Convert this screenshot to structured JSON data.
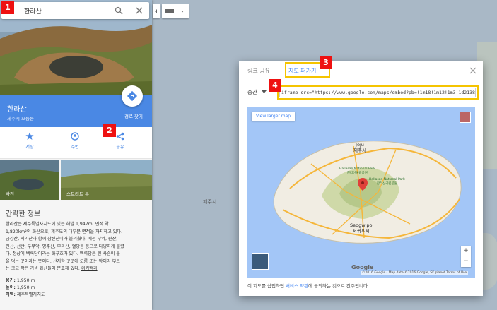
{
  "search": {
    "query": "한라산"
  },
  "place": {
    "title": "한라산",
    "subtitle": "제주시 오등동",
    "directions_label": "경로 찾기"
  },
  "actions": [
    {
      "label": "저장",
      "icon": "star-icon"
    },
    {
      "label": "주변",
      "icon": "nearby-icon"
    },
    {
      "label": "공유",
      "icon": "share-icon"
    }
  ],
  "photos": [
    {
      "label": "사진"
    },
    {
      "label": "스트리트 뷰"
    }
  ],
  "info": {
    "heading": "간략한 정보",
    "body_lines": [
      "한라산은 제주특별자치도에 있는 해발 1,947m, 면적 약",
      "1,820km²의 화산으로, 제주도의 대부분 면적을 차지하고 있다.",
      "금강산, 지리산과 함께 삼신산이라 불리웠다. 예전 부악, 원산,",
      "진산, 선산, 두무악, 영주산, 부라산, 혈망봉 등으로 다양하게 불렸",
      "다. 정상에 백록담이라는 화구호가 있다. 백록담은 흰 사슴이 물",
      "을 먹는 곳이라는 뜻이다. 산지학 곳곳에 오름 또는 악이라 부르",
      "는 크고 작은 기생 화산들이 분포해 있다."
    ],
    "wiki_link": "위키백과",
    "facts": [
      {
        "key": "융기:",
        "value": "1,950 m"
      },
      {
        "key": "높이:",
        "value": "1,950 m"
      },
      {
        "key": "지역:",
        "value": "제주특별자치도"
      }
    ]
  },
  "map_bg": {
    "label_left": "제주시"
  },
  "dialog": {
    "tabs": [
      {
        "label": "링크 공유"
      },
      {
        "label": "지도 퍼가기"
      }
    ],
    "active_tab": 1,
    "size_label": "중간",
    "embed_code": "iframe src=\"https://www.google.com/maps/embed?pb=!1m18!1m12!1m3!1d213805.0",
    "preview": {
      "larger_map": "View larger map",
      "labels": {
        "jeju_en": "Jeju",
        "jeju_ko": "제주시",
        "np_en": "Hallasan National Park",
        "np_ko": "한라산국립공원",
        "np2_en": "Hallasan National Park",
        "np2_ko": "한라산국립공원",
        "seogwipo_en": "Seogwipo",
        "seogwipo_ko": "서귀포시"
      },
      "google": "Google",
      "copyright": "©2016 Google - Map data ©2016 Google, SK planet   Terms of Use"
    },
    "terms": {
      "before": "이 지도를 삽입하면 ",
      "link": "서비스 약관",
      "after": "에 동의하는 것으로 간주됩니다."
    }
  },
  "badges": [
    "1",
    "2",
    "3",
    "4"
  ]
}
